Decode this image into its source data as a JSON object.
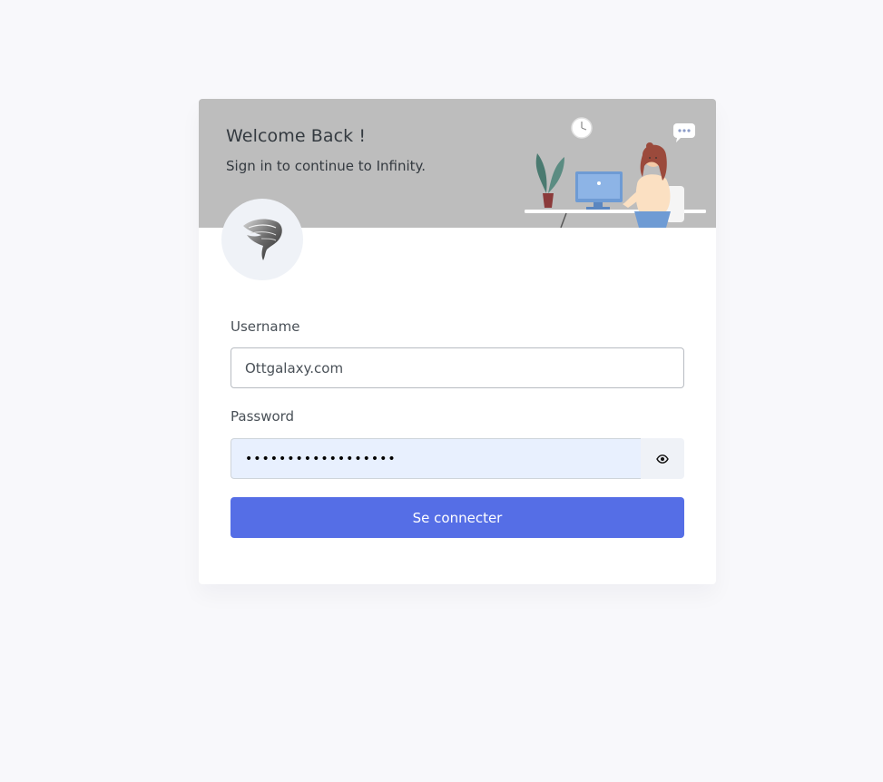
{
  "header": {
    "title": "Welcome Back !",
    "subtitle": "Sign in to continue to Infinity."
  },
  "form": {
    "username_label": "Username",
    "username_value": "Ottgalaxy.com",
    "password_label": "Password",
    "password_value": "••••••••••••••••••",
    "submit_label": "Se connecter"
  },
  "colors": {
    "page_background": "#f8f8fb",
    "header_background": "#bdbdbd",
    "primary": "#556ee6",
    "autofill": "#e8f0fe"
  },
  "icons": {
    "logo": "feather-logo-icon",
    "illustration": "office-worker-illustration",
    "password_toggle": "eye-icon"
  }
}
